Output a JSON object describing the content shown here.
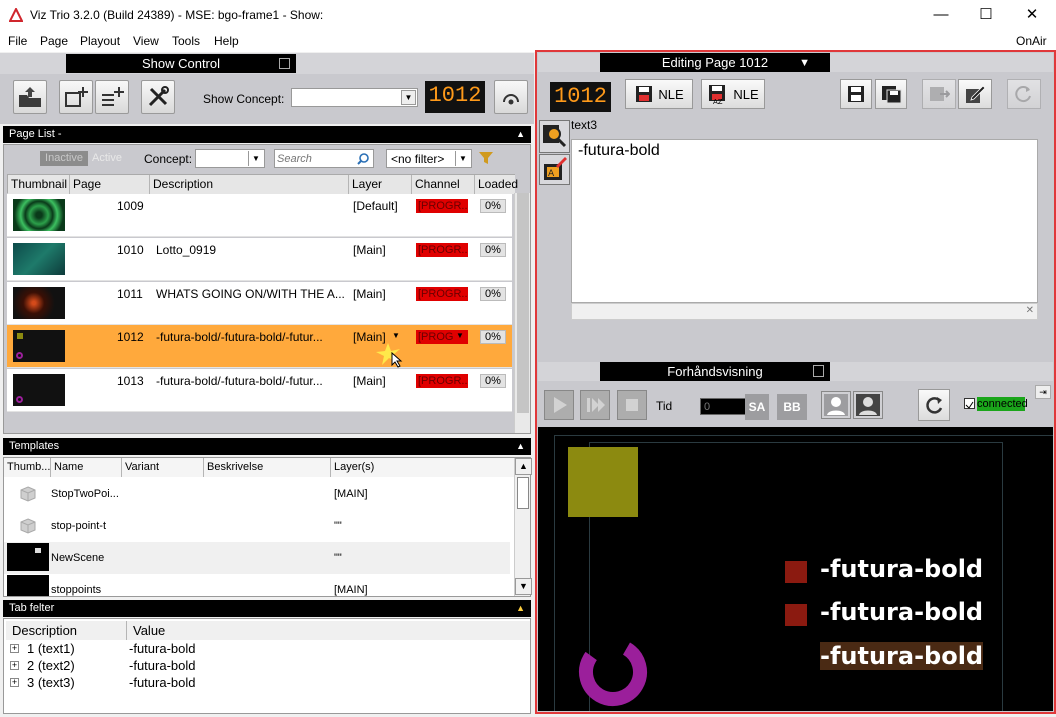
{
  "window": {
    "title": "Viz Trio 3.2.0 (Build 24389) - MSE: bgo-frame1 - Show:",
    "minimize": "—",
    "maximize": "☐",
    "close": "✕"
  },
  "menu": {
    "items": [
      "File",
      "Page",
      "Playout",
      "View",
      "Tools",
      "Help"
    ],
    "onair": "OnAir"
  },
  "show_control": {
    "title": "Show Control",
    "concept_label": "Show Concept:",
    "concept_value": "",
    "page_number": "1012"
  },
  "page_list": {
    "title": "Page List -",
    "inactive": "Inactive",
    "active": "Active",
    "concept_label": "Concept:",
    "search_placeholder": "Search",
    "filter": "<no filter>",
    "columns": [
      "Thumbnail",
      "Page",
      "Description",
      "Layer",
      "Channel",
      "Loaded"
    ],
    "rows": [
      {
        "page": "1009",
        "description": "",
        "layer": "[Default]",
        "channel": "[PROGR...",
        "loaded": "0%"
      },
      {
        "page": "1010",
        "description": "Lotto_0919",
        "layer": "[Main]",
        "channel": "[PROGR...",
        "loaded": "0%"
      },
      {
        "page": "1011",
        "description": "WHATS GOING ON/WITH THE A...",
        "layer": "[Main]",
        "channel": "[PROGR...",
        "loaded": "0%"
      },
      {
        "page": "1012",
        "description": "-futura-bold/-futura-bold/-futur...",
        "layer": "[Main]",
        "channel": "[PROG",
        "loaded": "0%"
      },
      {
        "page": "1013",
        "description": "-futura-bold/-futura-bold/-futur...",
        "layer": "[Main]",
        "channel": "[PROGR...",
        "loaded": "0%"
      }
    ]
  },
  "templates": {
    "title": "Templates",
    "columns": [
      "Thumb...",
      "Name",
      "Variant",
      "Beskrivelse",
      "Layer(s)"
    ],
    "rows": [
      {
        "name": "StopTwoPoi...",
        "layers": "[MAIN]"
      },
      {
        "name": "stop-point-t",
        "layers": "\"\""
      },
      {
        "name": "NewScene",
        "layers": "\"\""
      },
      {
        "name": "stoppoints",
        "layers": "[MAIN]"
      }
    ]
  },
  "tab_felter": {
    "title": "Tab felter",
    "columns": [
      "Description",
      "Value"
    ],
    "rows": [
      {
        "desc": "1 (text1)",
        "value": "-futura-bold"
      },
      {
        "desc": "2 (text2)",
        "value": "-futura-bold"
      },
      {
        "desc": "3 (text3)",
        "value": "-futura-bold"
      }
    ]
  },
  "editing": {
    "title": "Editing Page 1012",
    "page_number": "1012",
    "nle1": "NLE",
    "nle2": "NLE",
    "field_label": "text3",
    "field_value": "-futura-bold"
  },
  "preview": {
    "title": "Forhåndsvisning",
    "tid_label": "Tid",
    "tid_value": "0",
    "sa": "SA",
    "bb": "BB",
    "connected": "connected",
    "lines": [
      "-futura-bold",
      "-futura-bold",
      "-futura-bold"
    ]
  },
  "colors": {
    "accent": "#ff9d2e",
    "selected_row": "#ffa93c",
    "channel_red": "#e00000",
    "frame_red": "#e0383a",
    "magenta": "#9b1f9b",
    "olive": "#8c8a10",
    "darkred": "#8b1a10"
  }
}
